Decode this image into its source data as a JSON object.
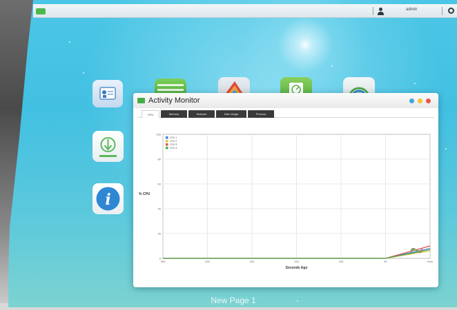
{
  "topbar": {
    "username": "admin"
  },
  "window": {
    "title": "Activity Monitor",
    "tabs": [
      {
        "label": "CPU",
        "active": true
      },
      {
        "label": "Memory",
        "active": false
      },
      {
        "label": "Network",
        "active": false
      },
      {
        "label": "Disk Usage",
        "active": false
      },
      {
        "label": "Process",
        "active": false
      }
    ]
  },
  "chart_data": {
    "type": "line",
    "ylabel": "% CPU",
    "xlabel": "Seconds Ago",
    "y_ticks": [
      "100",
      "80",
      "60",
      "40",
      "20",
      "0"
    ],
    "x_ticks": [
      "300",
      "250",
      "200",
      "150",
      "100",
      "50",
      "Now"
    ],
    "ylim": [
      0,
      100
    ],
    "grid": true,
    "legend_position": "top-left",
    "series": [
      {
        "name": "CPU 1",
        "color": "#3d7fd6",
        "values": [
          0,
          0,
          0,
          0,
          0,
          0,
          8
        ]
      },
      {
        "name": "CPU 2",
        "color": "#e8c14a",
        "values": [
          0,
          0,
          0,
          0,
          0,
          0,
          6
        ]
      },
      {
        "name": "CPU 3",
        "color": "#d9534f",
        "values": [
          0,
          0,
          0,
          0,
          0,
          0,
          10
        ]
      },
      {
        "name": "CPU 4",
        "color": "#4caf50",
        "values": [
          0,
          0,
          0,
          0,
          0,
          0,
          7
        ]
      }
    ]
  },
  "page_label": "New Page 1"
}
